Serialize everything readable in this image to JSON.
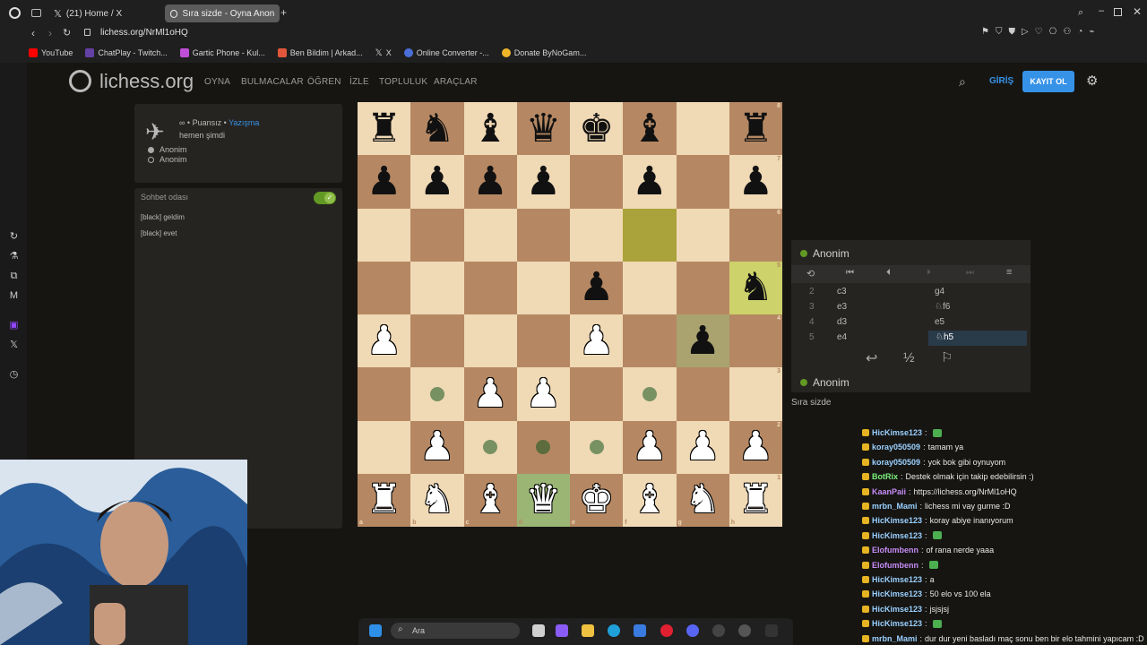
{
  "browser": {
    "tabs": [
      {
        "label": "(21) Home / X"
      },
      {
        "label": "Sıra sizde - Oyna Anon..."
      }
    ],
    "url": "lichess.org/NrMl1oHQ",
    "bookmarks": [
      {
        "label": "YouTube",
        "color": "#ff0000"
      },
      {
        "label": "ChatPlay - Twitch...",
        "color": "#6441a5"
      },
      {
        "label": "Gartic Phone - Kul...",
        "color": "#c04fd8"
      },
      {
        "label": "Ben Bildim | Arkad...",
        "color": "#e2573b"
      },
      {
        "label": "X",
        "color": "#dddddd"
      },
      {
        "label": "Online Converter -...",
        "color": "#4a6fd8"
      },
      {
        "label": "Donate ByNoGam...",
        "color": "#f0b429"
      }
    ]
  },
  "site": {
    "logo": "lichess.org",
    "nav": [
      "OYNA",
      "BULMACALAR",
      "ÖĞREN",
      "İZLE",
      "TOPLULUK",
      "ARAÇLAR"
    ],
    "login": "GİRİŞ",
    "signup": "KAYIT OL"
  },
  "game_info": {
    "line1_prefix": "∞ • Puansız • ",
    "line1_link": "Yazışma",
    "time": "hemen şimdi",
    "player_white": "Anonim",
    "player_black": "Anonim"
  },
  "chat": {
    "title": "Sohbet odası",
    "messages": [
      "[black] geldim",
      "[black] evet"
    ]
  },
  "board": {
    "rows": [
      [
        "br",
        "bn",
        "bb",
        "bq",
        "bk",
        "bb",
        "",
        "br"
      ],
      [
        "bp",
        "bp",
        "bp",
        "bp",
        "",
        "bp",
        "",
        "bp"
      ],
      [
        "",
        "",
        "",
        "",
        "",
        "",
        "",
        ""
      ],
      [
        "",
        "",
        "",
        "",
        "bp",
        "",
        "",
        "bn"
      ],
      [
        "wp",
        "",
        "",
        "",
        "wp",
        "",
        "bp",
        ""
      ],
      [
        "",
        "",
        "wp",
        "wp",
        "",
        "",
        "",
        ""
      ],
      [
        "",
        "wp",
        "",
        "",
        "",
        "wp",
        "wp",
        "wp"
      ],
      [
        "wr",
        "wn",
        "wb",
        "wq",
        "wk",
        "wb",
        "wn",
        "wr"
      ]
    ],
    "files": [
      "a",
      "b",
      "c",
      "d",
      "e",
      "f",
      "g",
      "h"
    ],
    "ranks": [
      "8",
      "7",
      "6",
      "5",
      "4",
      "3",
      "2",
      "1"
    ]
  },
  "moves_panel": {
    "top_player": "Anonim",
    "bottom_player": "Anonim",
    "status": "Sıra sizde",
    "moves": [
      {
        "n": "2",
        "w": "c3",
        "b": "g4"
      },
      {
        "n": "3",
        "w": "e3",
        "b": "♘f6"
      },
      {
        "n": "4",
        "w": "d3",
        "b": "e5"
      },
      {
        "n": "5",
        "w": "e4",
        "b": "♘h5"
      }
    ]
  },
  "twitch_chat": [
    {
      "user": "HicKimse123",
      "msg": "",
      "color": "#9ad0ff"
    },
    {
      "user": "koray050509",
      "msg": "tamam ya",
      "color": "#9ad0ff"
    },
    {
      "user": "koray050509",
      "msg": "yok bok gibi oynuyom",
      "color": "#9ad0ff"
    },
    {
      "user": "BotRix",
      "msg": "Destek olmak için takip edebilirsin :)",
      "color": "#7cf07c"
    },
    {
      "user": "KaanPaii",
      "msg": "https://lichess.org/NrMl1oHQ",
      "color": "#c58cf5"
    },
    {
      "user": "mrbn_Mami",
      "msg": "lichess mi vay gurme :D",
      "color": "#9ad0ff"
    },
    {
      "user": "HicKimse123",
      "msg": "koray abiye inanıyorum",
      "color": "#9ad0ff"
    },
    {
      "user": "HicKimse123",
      "msg": "",
      "color": "#9ad0ff"
    },
    {
      "user": "Elofumbenn",
      "msg": "of rana nerde yaaa",
      "color": "#c58cf5"
    },
    {
      "user": "Elofumbenn",
      "msg": "",
      "color": "#c58cf5"
    },
    {
      "user": "HicKimse123",
      "msg": "a",
      "color": "#9ad0ff"
    },
    {
      "user": "HicKimse123",
      "msg": "50 elo vs 100 ela",
      "color": "#9ad0ff"
    },
    {
      "user": "HicKimse123",
      "msg": "jsjsjsj",
      "color": "#9ad0ff"
    },
    {
      "user": "HicKimse123",
      "msg": "",
      "color": "#9ad0ff"
    },
    {
      "user": "mrbn_Mami",
      "msg": "dur dur yeni basladı maç sonu ben bir elo tahmini yapıcam :D",
      "color": "#9ad0ff"
    }
  ],
  "taskbar": {
    "search": "Ara"
  }
}
